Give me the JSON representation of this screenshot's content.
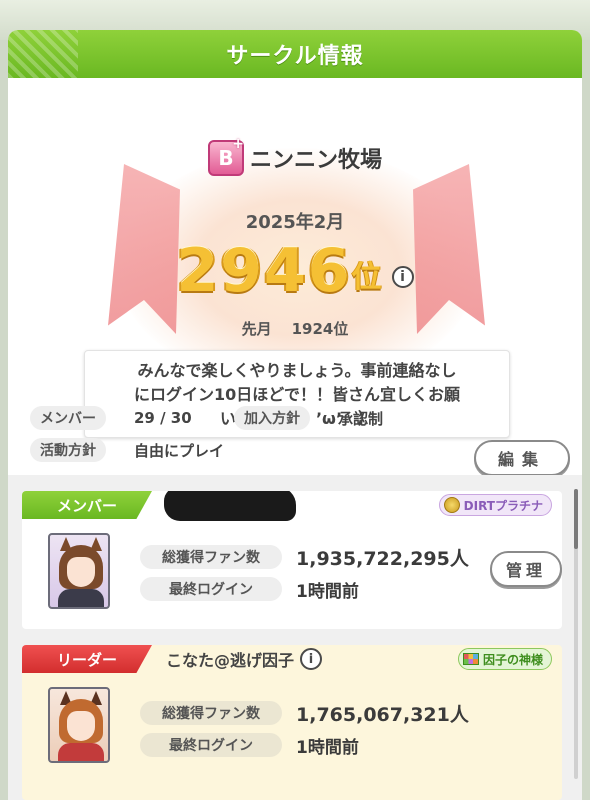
{
  "header": {
    "title": "サークル情報"
  },
  "circle": {
    "rank_letter": "B",
    "rank_plus": "+",
    "name": "ニンニン牧場",
    "month": "2025年2月",
    "rank": "2946",
    "rank_unit": "位",
    "info_glyph": "i",
    "last_month_label": "先月",
    "last_month_rank": "1924位",
    "message_lines": [
      "みんなで楽しくやりましょう。事前連絡なし",
      "にログイン10日ほどで！！皆さん宜しくお願",
      "いします（　’ω’　）"
    ]
  },
  "meta": {
    "members_label": "メンバー",
    "members_value": "29 / 30",
    "policy_label": "加入方針",
    "policy_value": "承認制",
    "activity_label": "活動方針",
    "activity_value": "自由にプレイ",
    "edit_button": "編集"
  },
  "members": [
    {
      "role": "メンバー",
      "name": "",
      "title": "DIRTプラチナ",
      "fans_label": "総獲得ファン数",
      "fans_value": "1,935,722,295人",
      "login_label": "最終ログイン",
      "login_value": "1時間前",
      "manage_button": "管理"
    },
    {
      "role": "リーダー",
      "name": "こなた@逃げ因子",
      "title": "因子の神様",
      "fans_label": "総獲得ファン数",
      "fans_value": "1,765,067,321人",
      "login_label": "最終ログイン",
      "login_value": "1時間前"
    }
  ],
  "colors": {
    "header_green": "#6ab822",
    "leader_red": "#d22e2e",
    "rank_gold": "#f5c034",
    "rank_badge_pink": "#e25c95"
  }
}
